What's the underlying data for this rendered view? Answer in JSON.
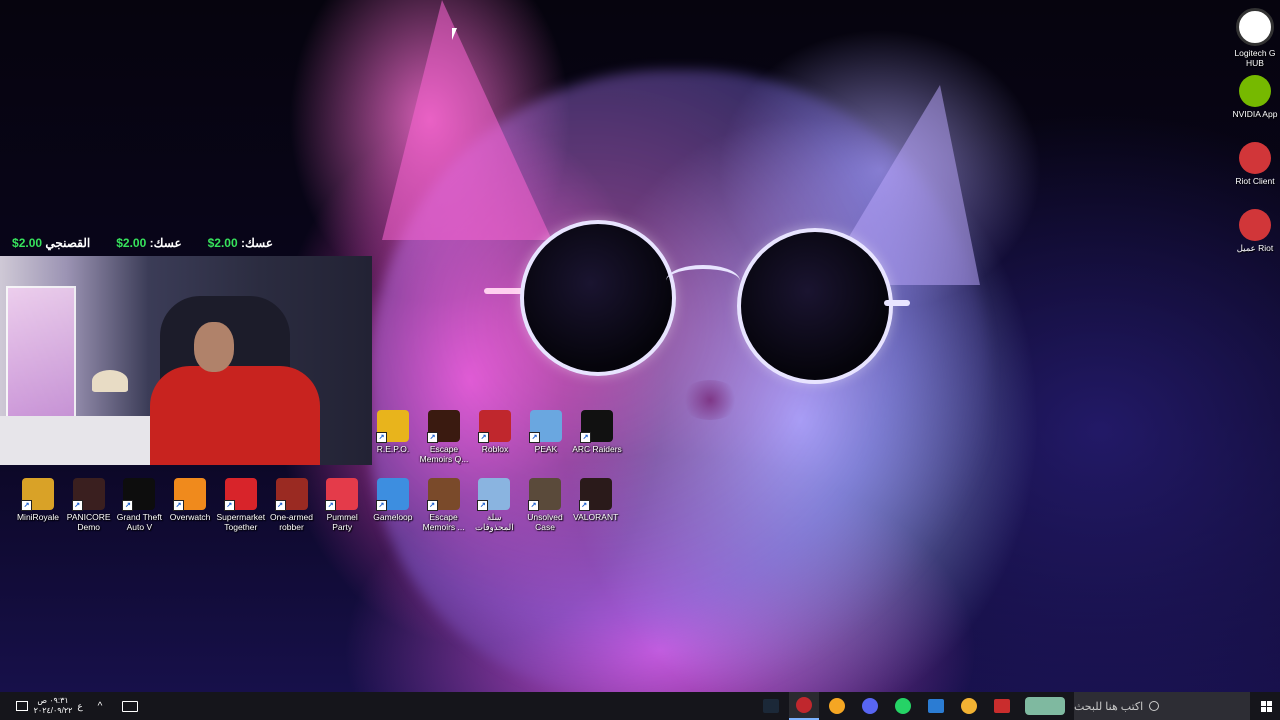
{
  "donations": [
    {
      "name": "القصنجي",
      "amount": "2.00$"
    },
    {
      "name": "عسك:",
      "amount": "2.00$"
    },
    {
      "name": "عسك:",
      "amount": "2.00$"
    }
  ],
  "desktop": {
    "row1": [
      {
        "label": "R.E.P.O.",
        "icon": "repo-icon",
        "color": "#e8b41c"
      },
      {
        "label": "Escape Memoirs Q...",
        "icon": "escape-memoirs-icon",
        "color": "#3a1a10"
      },
      {
        "label": "Roblox",
        "icon": "roblox-icon",
        "color": "#c0272d"
      },
      {
        "label": "PEAK",
        "icon": "peak-icon",
        "color": "#6aa7e0"
      },
      {
        "label": "ARC Raiders",
        "icon": "arc-raiders-icon",
        "color": "#111111"
      }
    ],
    "row2": [
      {
        "label": "MiniRoyale",
        "icon": "miniroyale-icon",
        "color": "#d9a227"
      },
      {
        "label": "PANICORE Demo",
        "icon": "panicore-icon",
        "color": "#3a1f1f"
      },
      {
        "label": "Grand Theft Auto V",
        "icon": "gta-v-icon",
        "color": "#0d0d0d"
      },
      {
        "label": "Overwatch",
        "icon": "overwatch-icon",
        "color": "#f08a1c"
      },
      {
        "label": "Supermarket Together",
        "icon": "supermarket-together-icon",
        "color": "#d8242a"
      },
      {
        "label": "One-armed robber",
        "icon": "one-armed-robber-icon",
        "color": "#9a2a22"
      },
      {
        "label": "Pummel Party",
        "icon": "pummel-party-icon",
        "color": "#e43b4a"
      },
      {
        "label": "Gameloop",
        "icon": "gameloop-icon",
        "color": "#3d8ee0"
      },
      {
        "label": "Escape Memoirs ...",
        "icon": "escape-memoirs-2-icon",
        "color": "#7a4a2a"
      },
      {
        "label": "سلة المحذوفات",
        "icon": "recycle-bin-icon",
        "color": "#8ab4e0"
      },
      {
        "label": "Unsolved Case",
        "icon": "unsolved-case-icon",
        "color": "#5a4a3a"
      },
      {
        "label": "VALORANT",
        "icon": "valorant-icon",
        "color": "#2a1a1a"
      }
    ],
    "right": [
      {
        "label": "Logitech G HUB",
        "icon": "logitech-ghub-icon",
        "color": "#ffffff"
      },
      {
        "label": "NVIDIA App",
        "icon": "nvidia-app-icon",
        "color": "#76b900"
      },
      {
        "label": "Riot Client",
        "icon": "riot-client-icon",
        "color": "#d13639"
      },
      {
        "label": "عميل Riot",
        "icon": "riot-client-ar-icon",
        "color": "#d13639"
      }
    ]
  },
  "taskbar": {
    "search_placeholder": "اكتب هنا للبحث",
    "clock_time": "٠٩:٣١ ص",
    "clock_date": "٢٠٢٤/٠٩/٢٢",
    "lang": "ع",
    "chevron": "^",
    "apps": [
      {
        "name": "steam-icon",
        "color": "#1b2838",
        "active": false
      },
      {
        "name": "obs-icon",
        "color": "#c0272d",
        "active": true
      },
      {
        "name": "discord-small-icon",
        "color": "#f5a623",
        "active": false
      },
      {
        "name": "discord-icon",
        "color": "#5865f2",
        "active": false
      },
      {
        "name": "whatsapp-icon",
        "color": "#25d366",
        "active": false
      },
      {
        "name": "mail-icon",
        "color": "#2b7cd3",
        "active": false
      },
      {
        "name": "chrome-icon",
        "color": "#f2b233",
        "active": false
      },
      {
        "name": "video-app-icon",
        "color": "#c92d2d",
        "active": false
      },
      {
        "name": "weather-icon",
        "color": "#7fb9a0",
        "active": false
      }
    ]
  }
}
